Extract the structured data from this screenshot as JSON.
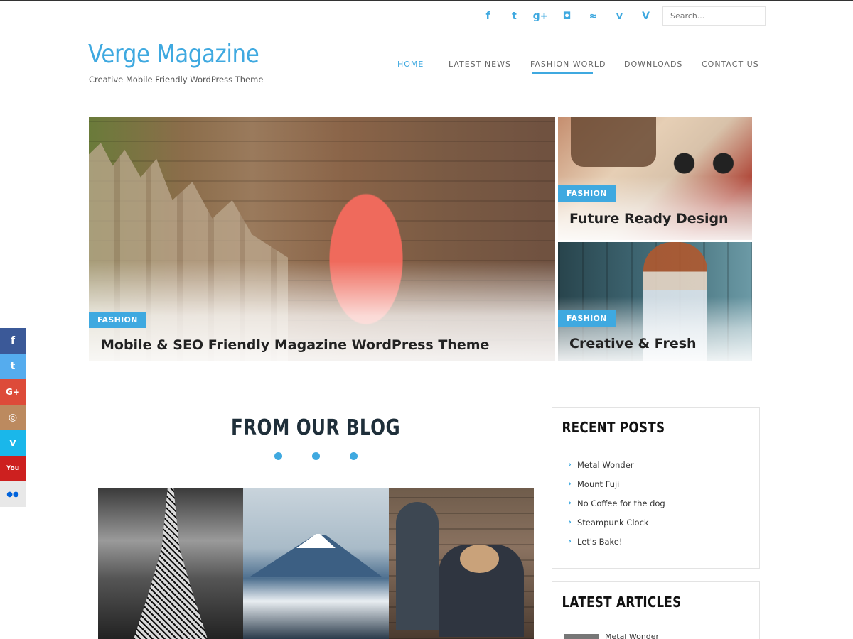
{
  "social_top": [
    {
      "icon": "facebook-icon",
      "glyph": "f"
    },
    {
      "icon": "twitter-icon",
      "glyph": "t"
    },
    {
      "icon": "google-plus-icon",
      "glyph": "g+"
    },
    {
      "icon": "instagram-icon",
      "glyph": "◘"
    },
    {
      "icon": "rss-icon",
      "glyph": "≈"
    },
    {
      "icon": "vine-icon",
      "glyph": "v"
    },
    {
      "icon": "vimeo-icon",
      "glyph": "V"
    }
  ],
  "search": {
    "placeholder": "Search..."
  },
  "site": {
    "title": "Verge Magazine",
    "tagline": "Creative Mobile Friendly WordPress Theme",
    "accent": "#3fa9e0"
  },
  "nav": {
    "home": "HOME",
    "latest_news": "LATEST NEWS",
    "fashion_world": "FASHION WORLD",
    "downloads": "DOWNLOADS",
    "contact_us": "CONTACT US",
    "active": "FASHION WORLD"
  },
  "featured": {
    "main": {
      "badge": "FASHION",
      "title": "Mobile & SEO Friendly Magazine WordPress Theme"
    },
    "right_top": {
      "badge": "FASHION",
      "title": "Future Ready Design"
    },
    "right_bottom": {
      "badge": "FASHION",
      "title": "Creative & Fresh"
    }
  },
  "blog": {
    "title": "FROM OUR BLOG"
  },
  "recent_posts": {
    "title": "RECENT POSTS",
    "items": [
      "Metal Wonder",
      "Mount Fuji",
      "No Coffee for the dog",
      "Steampunk Clock",
      "Let's Bake!"
    ]
  },
  "latest_articles": {
    "title": "LATEST ARTICLES",
    "first_item": "Metal Wonder"
  },
  "share_bar": [
    {
      "icon": "facebook-icon",
      "glyph": "f",
      "color": "#3b5998"
    },
    {
      "icon": "twitter-icon",
      "glyph": "t",
      "color": "#55acee"
    },
    {
      "icon": "google-plus-icon",
      "glyph": "G+",
      "color": "#dd4b39"
    },
    {
      "icon": "instagram-icon",
      "glyph": "◎",
      "color": "#bc8a5f"
    },
    {
      "icon": "vimeo-icon",
      "glyph": "v",
      "color": "#1ab7ea"
    },
    {
      "icon": "youtube-icon",
      "glyph": "You",
      "color": "#cd201f"
    },
    {
      "icon": "flickr-icon",
      "glyph": "●●",
      "color": "#e8e8e8"
    }
  ]
}
